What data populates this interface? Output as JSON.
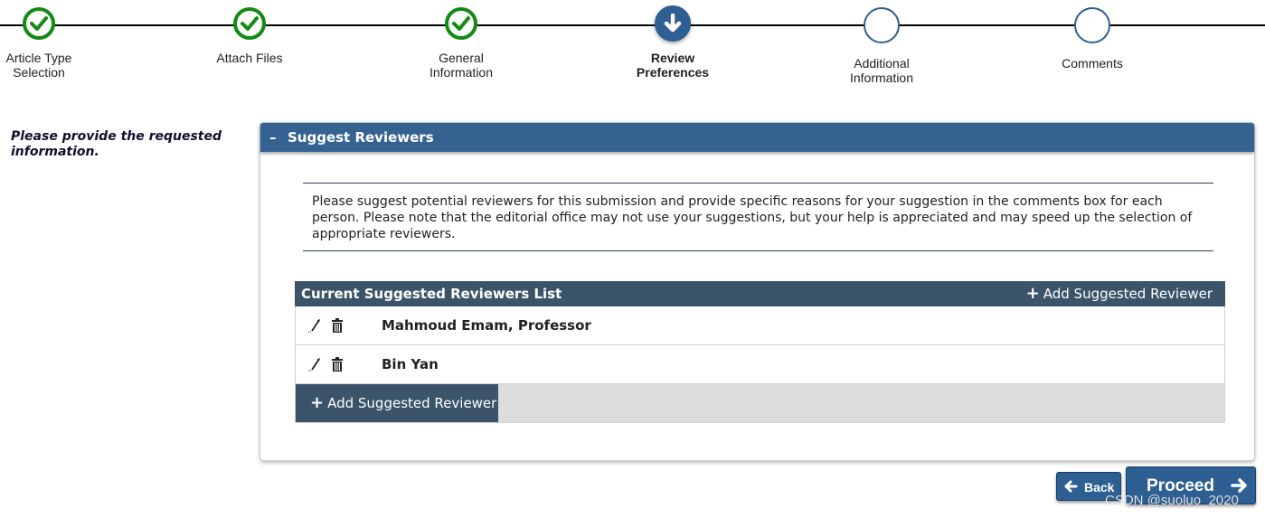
{
  "stepper": {
    "steps": [
      {
        "label": "Article Type\nSelection",
        "status": "done"
      },
      {
        "label": "Attach Files",
        "status": "done"
      },
      {
        "label": "General\nInformation",
        "status": "done"
      },
      {
        "label": "Review\nPreferences",
        "status": "current"
      },
      {
        "label": "Additional\nInformation",
        "status": "todo"
      },
      {
        "label": "Comments",
        "status": "todo"
      }
    ]
  },
  "instruction": "Please provide the requested information.",
  "panel": {
    "toggle": "–",
    "title": "Suggest Reviewers",
    "note": "Please suggest potential reviewers for this submission and provide specific reasons for your suggestion in the comments box for each person. Please note that the editorial office may not use your suggestions, but your help is appreciated and may speed up the selection of appropriate reviewers."
  },
  "reviewers": {
    "header_title": "Current Suggested Reviewers List",
    "header_add_label": "Add Suggested Reviewer",
    "rows": [
      {
        "name": "Mahmoud Emam, Professor"
      },
      {
        "name": "Bin Yan"
      }
    ],
    "footer_add_label": "Add Suggested Reviewer"
  },
  "buttons": {
    "back": "Back",
    "proceed": "Proceed"
  },
  "watermark": "CSDN @suoluo_2020",
  "colors": {
    "header_blue": "#346392",
    "list_header": "#3b5469",
    "done_green": "#138a13",
    "step_blue": "#2e5f92"
  },
  "icons": {
    "done": "check-icon",
    "current": "down-arrow-icon",
    "edit": "pencil-icon",
    "delete": "trash-icon",
    "add": "plus-icon",
    "back": "left-arrow-icon",
    "proceed": "right-arrow-icon"
  }
}
